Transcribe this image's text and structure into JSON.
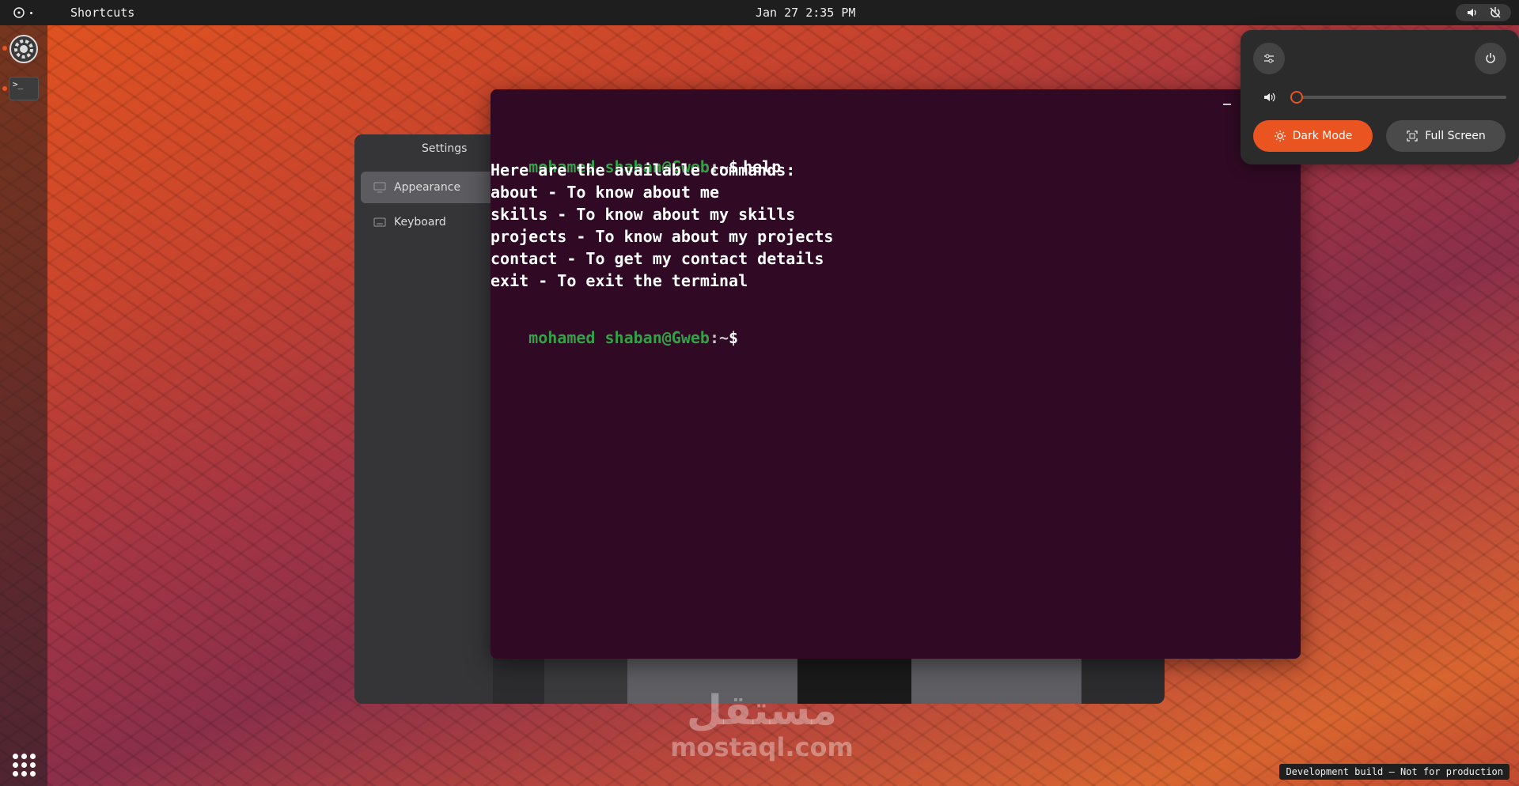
{
  "topbar": {
    "activities_label": "Shortcuts",
    "clock": "Jan 27 2:35 PM"
  },
  "settings": {
    "title": "Settings",
    "items": [
      {
        "label": "Appearance",
        "icon": "display-icon"
      },
      {
        "label": "Keyboard",
        "icon": "keyboard-icon"
      }
    ]
  },
  "terminal": {
    "prompt_user": "mohamed shaban@Gweb",
    "prompt_sep": ":~",
    "prompt_symbol": "$",
    "command": "help",
    "output": [
      "Here are the available commands:",
      "about - To know about me",
      "skills - To know about my skills",
      "projects - To know about my projects",
      "contact - To get my contact details",
      "exit - To exit the terminal"
    ]
  },
  "quick_settings": {
    "volume_level": 0,
    "dark_mode_label": "Dark Mode",
    "full_screen_label": "Full Screen"
  },
  "watermark": {
    "arabic": "مستقل",
    "latin": "mostaql.com"
  },
  "dev_badge": "Development build — Not for production",
  "colors": {
    "accent": "#e95420",
    "terminal_bg": "#300a24",
    "prompt_green": "#33a145"
  }
}
